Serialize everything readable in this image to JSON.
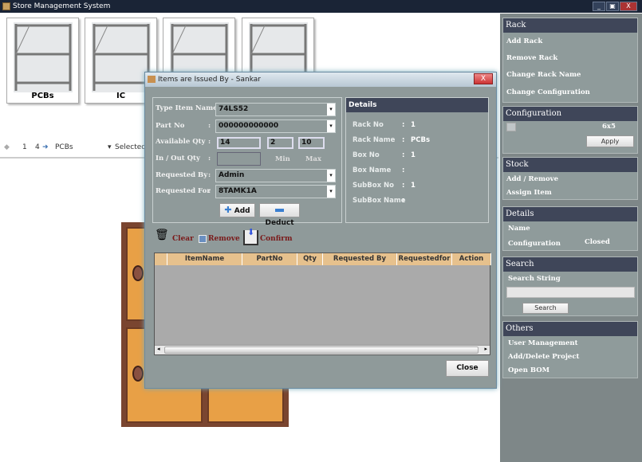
{
  "window": {
    "title": "Store Management System",
    "controls": [
      "_",
      "▣",
      "X"
    ]
  },
  "racks": [
    {
      "label": "PCBs"
    },
    {
      "label": "IC"
    },
    {
      "label": ""
    },
    {
      "label": ""
    }
  ],
  "rackbar": {
    "page": "1",
    "count": "4",
    "rack": "PCBs",
    "selected": "Selected Ra"
  },
  "panel": {
    "rack": {
      "title": "Rack",
      "items": [
        "Add Rack",
        "Remove Rack",
        "Change Rack Name",
        "Change Configuration"
      ]
    },
    "configuration": {
      "title": "Configuration",
      "value": "6x5",
      "apply": "Apply"
    },
    "stock": {
      "title": "Stock",
      "items": [
        "Add / Remove",
        "Assign Item"
      ]
    },
    "details": {
      "title": "Details",
      "name_label": "Name",
      "config_label": "Configuration",
      "config_value": "Closed"
    },
    "search": {
      "title": "Search",
      "label": "Search String",
      "value": "",
      "button": "Search"
    },
    "others": {
      "title": "Others",
      "items": [
        "User Management",
        "Add/Delete Project",
        "Open BOM"
      ]
    }
  },
  "dialog": {
    "title": "Items are Issued By - Sankar",
    "close_x": "X",
    "form": {
      "type_item_name_label": "Type Item Name :",
      "type_item_name": "74LS52",
      "part_no_label": "Part No",
      "part_no": "000000000000",
      "available_qty_label": "Available Qty",
      "available_qty": "14",
      "min": "2",
      "max": "10",
      "inout_qty_label": "In / Out Qty",
      "inout_qty": "",
      "min_label": "Min",
      "max_label": "Max",
      "requested_by_label": "Requested By",
      "requested_by": "Admin",
      "requested_for_label": "Requested For",
      "requested_for": "8TAMK1A",
      "colon": ":",
      "add": "Add",
      "deduct": "Deduct"
    },
    "details": {
      "title": "Details",
      "rows": [
        {
          "label": "Rack No",
          "value": "1"
        },
        {
          "label": "Rack Name",
          "value": "PCBs"
        },
        {
          "label": "Box No",
          "value": "1"
        },
        {
          "label": "Box Name",
          "value": ""
        },
        {
          "label": "SubBox No",
          "value": "1"
        },
        {
          "label": "SubBox Name",
          "value": ""
        }
      ]
    },
    "actions": {
      "clear": "Clear",
      "remove": "Remove",
      "confirm": "Confirm"
    },
    "grid": {
      "columns": [
        "ItemName",
        "PartNo",
        "Qty",
        "Requested By",
        "Requestedfor",
        "Action"
      ],
      "rows": []
    },
    "close": "Close"
  },
  "colors": {
    "header": "#3f4659",
    "panel": "#8f9b9b",
    "grid_header": "#e6c18d",
    "action_text": "#7a1a1a"
  }
}
